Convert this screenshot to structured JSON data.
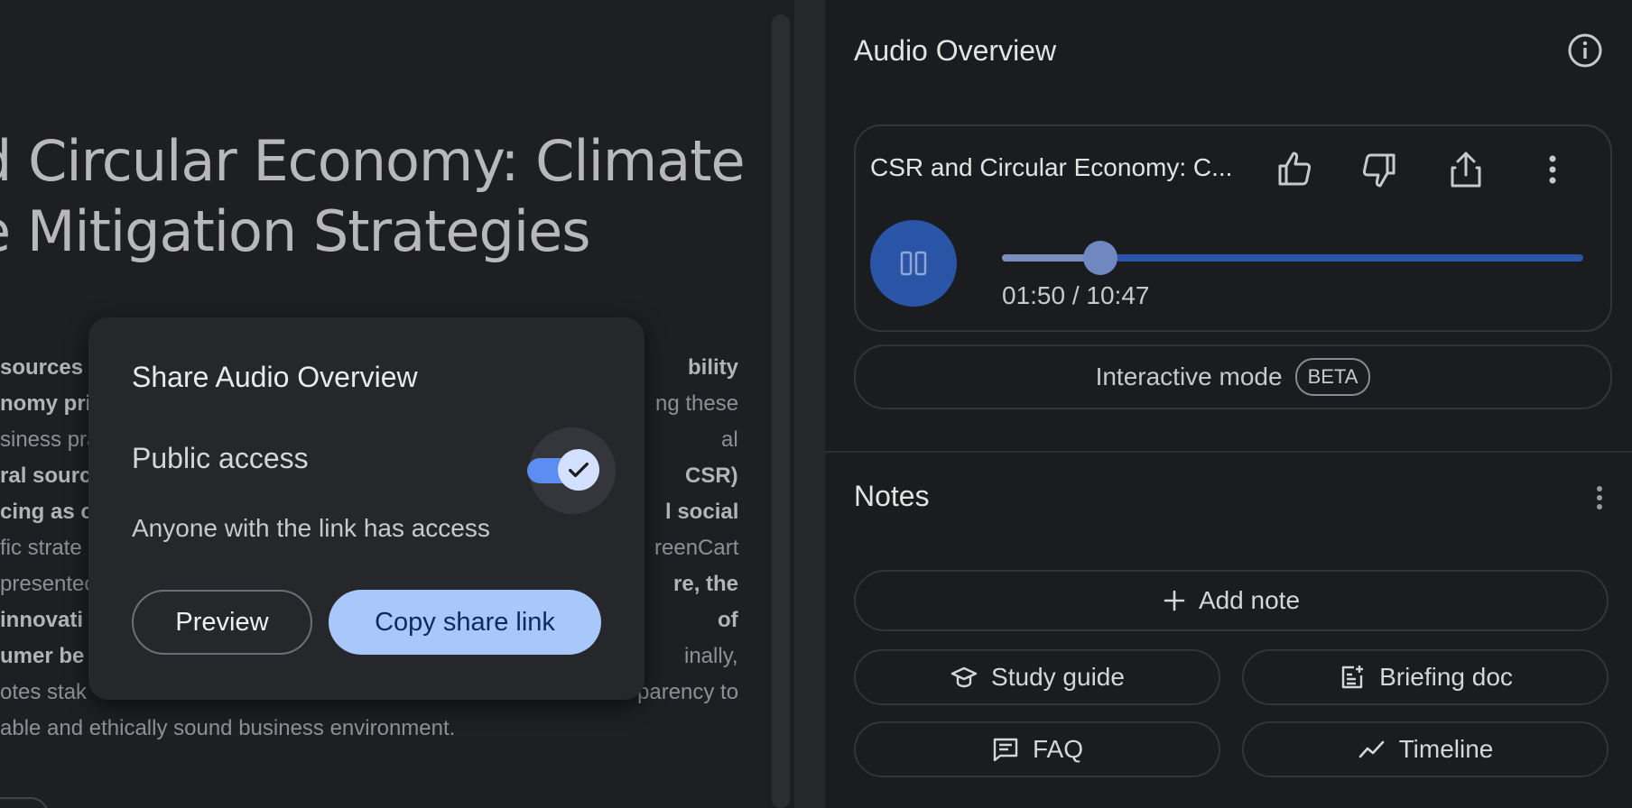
{
  "document": {
    "title_lines": [
      "d Circular Economy: Climate",
      "e Mitigation Strategies"
    ],
    "paragraph": [
      {
        "a": " sources",
        "b": "bility",
        "bold_a": true,
        "bold_b": true
      },
      {
        "a": "nomy pri",
        "b": "ng these",
        "bold_a": true,
        "bold_b": false
      },
      {
        "a": "siness pra",
        "b": "al",
        "bold_a": false,
        "bold_b": false
      },
      {
        "a": "ral sourc",
        "b": "CSR)",
        "bold_a": true,
        "bold_b": true
      },
      {
        "a": "cing as c",
        "b": "l social",
        "bold_a": true,
        "bold_b": true
      },
      {
        "a": "fic strate",
        "b": "reenCart",
        "bold_a": false,
        "bold_b": false
      },
      {
        "a": "presentec",
        "b": "re, the",
        "bold_a": false,
        "bold_b": true
      },
      {
        "a": "innovati",
        "b": "of",
        "bold_a": true,
        "bold_b": true
      },
      {
        "a": "umer be",
        "b": "inally,",
        "bold_a": true,
        "bold_b": false
      },
      {
        "a": "otes stak",
        "b": "parency to",
        "bold_a": false,
        "bold_b": false
      },
      {
        "a": "able and ethically sound business environment.",
        "b": "",
        "bold_a": false,
        "bold_b": false
      }
    ]
  },
  "share_dialog": {
    "title": "Share Audio Overview",
    "public_access_label": "Public access",
    "public_access_enabled": true,
    "description": "Anyone with the link has access",
    "preview_label": "Preview",
    "copy_label": "Copy share link"
  },
  "audio_overview": {
    "header": "Audio Overview",
    "card_title": "CSR and Circular Economy: C...",
    "progress_fraction": 0.17,
    "time_text": "01:50 / 10:47",
    "interactive_mode_label": "Interactive mode",
    "beta_badge": "BETA"
  },
  "notes": {
    "title": "Notes",
    "add_note_label": "Add note",
    "buttons": {
      "study_guide": "Study guide",
      "briefing_doc": "Briefing doc",
      "faq": "FAQ",
      "timeline": "Timeline"
    }
  },
  "colors": {
    "accent": "#a8c7fa",
    "play_button": "#2a54a6",
    "toggle_track": "#5b8ef0",
    "background": "#1b1c1f"
  }
}
